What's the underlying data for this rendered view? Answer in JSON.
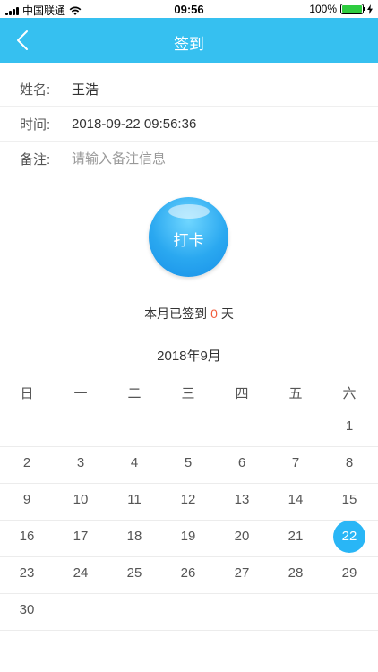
{
  "status_bar": {
    "carrier": "中国联通",
    "time": "09:56",
    "battery_percent": "100%",
    "battery_level": 1.0,
    "battery_color": "#2ecc40"
  },
  "nav": {
    "title": "签到",
    "back_icon": "chevron-left-icon",
    "background": "#36c0f0"
  },
  "form": {
    "name_label": "姓名:",
    "name_value": "王浩",
    "time_label": "时间:",
    "time_value": "2018-09-22 09:56:36",
    "note_label": "备注:",
    "note_placeholder": "请输入备注信息"
  },
  "checkin": {
    "button_label": "打卡",
    "summary_prefix": "本月已签到",
    "summary_count": "0",
    "summary_suffix": "天",
    "count_color": "#f25c3c"
  },
  "calendar": {
    "title": "2018年9月",
    "weekdays": [
      "日",
      "一",
      "二",
      "三",
      "四",
      "五",
      "六"
    ],
    "weeks": [
      [
        "",
        "",
        "",
        "",
        "",
        "",
        "1"
      ],
      [
        "2",
        "3",
        "4",
        "5",
        "6",
        "7",
        "8"
      ],
      [
        "9",
        "10",
        "11",
        "12",
        "13",
        "14",
        "15"
      ],
      [
        "16",
        "17",
        "18",
        "19",
        "20",
        "21",
        "22"
      ],
      [
        "23",
        "24",
        "25",
        "26",
        "27",
        "28",
        "29"
      ],
      [
        "30",
        "",
        "",
        "",
        "",
        "",
        ""
      ]
    ],
    "selected_day": "22",
    "selected_color": "#29b6f6"
  }
}
